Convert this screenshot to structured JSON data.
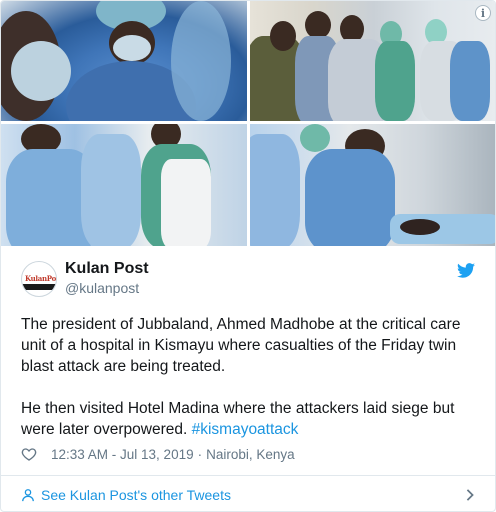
{
  "media": {
    "info_icon": "i",
    "photos": [
      {
        "icon": "photo-surgeons"
      },
      {
        "icon": "photo-hallway"
      },
      {
        "icon": "photo-ward"
      },
      {
        "icon": "photo-patient"
      }
    ]
  },
  "header": {
    "avatar_logo": "KulanPost",
    "name": "Kulan Post",
    "handle": "@kulanpost",
    "brand_icon": "twitter-bird-icon",
    "brand_color": "#1da1f2"
  },
  "tweet": {
    "paragraph1": "The president of Jubbaland, Ahmed Madhobe at the critical care unit of a hospital in Kismayu where casualties of the Friday twin blast attack are being treated.",
    "paragraph2_text": "He then visited Hotel Madina where the attackers laid siege but were later overpowered. ",
    "hashtag": "#kismayoattack",
    "link_color": "#1b95e0"
  },
  "meta": {
    "time": "12:33 AM - Jul 13, 2019",
    "separator": "·",
    "location": "Nairobi, Kenya"
  },
  "footer": {
    "label": "See Kulan Post's other Tweets"
  }
}
